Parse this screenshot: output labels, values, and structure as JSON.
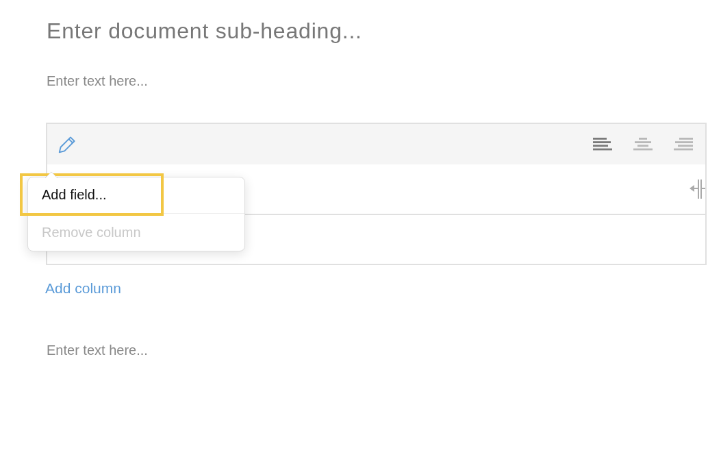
{
  "subheading": {
    "placeholder": "Enter document sub-heading..."
  },
  "text_blocks": [
    {
      "placeholder": "Enter text here..."
    }
  ],
  "table": {
    "alignments": [
      {
        "kind": "left",
        "selected": true
      },
      {
        "kind": "center",
        "selected": false
      },
      {
        "kind": "right",
        "selected": false
      }
    ],
    "menu": [
      {
        "label": "Add field...",
        "disabled": false,
        "highlighted": true
      },
      {
        "label": "Remove column",
        "disabled": true,
        "highlighted": false
      }
    ],
    "add_column": "Add column"
  },
  "text_blocks_after": [
    {
      "placeholder": "Enter text here..."
    }
  ]
}
